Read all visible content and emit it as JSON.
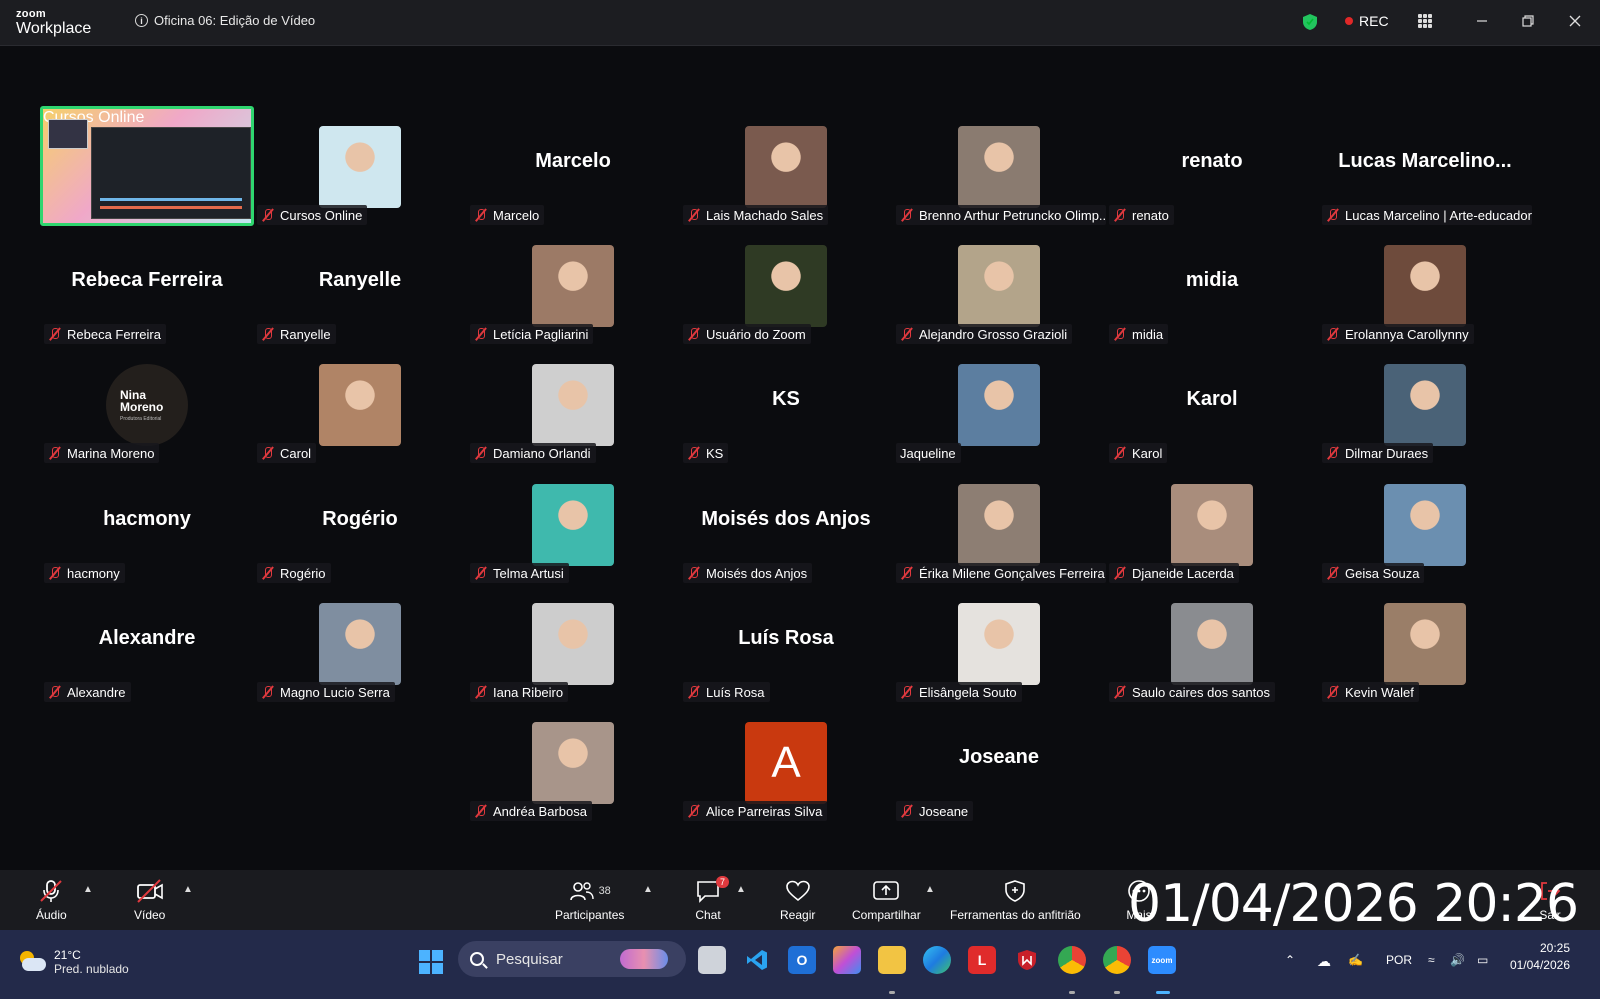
{
  "titlebar": {
    "logo_top": "zoom",
    "logo_bottom": "Workplace",
    "meeting_title": "Oficina 06: Edição de Vídeo",
    "rec_label": "REC",
    "icons": [
      "info-icon",
      "shield-icon",
      "apps-icon",
      "minimize-icon",
      "restore-icon",
      "close-icon"
    ]
  },
  "participants": [
    {
      "label": "Cursos Online",
      "big": "",
      "kind": "share"
    },
    {
      "label": "Cursos Online",
      "big": "",
      "kind": "photo",
      "color": "#cfe7ef"
    },
    {
      "label": "Marcelo",
      "big": "Marcelo",
      "kind": "name"
    },
    {
      "label": "Lais Machado Sales",
      "big": "",
      "kind": "photo",
      "color": "#7a5a4e"
    },
    {
      "label": "Brenno Arthur Petruncko Olimp...",
      "big": "",
      "kind": "photo",
      "color": "#8a7b70"
    },
    {
      "label": "renato",
      "big": "renato",
      "kind": "name"
    },
    {
      "label": "Lucas Marcelino | Arte-educador",
      "big": "Lucas  Marcelino...",
      "kind": "name"
    },
    {
      "label": "Rebeca Ferreira",
      "big": "Rebeca Ferreira",
      "kind": "name"
    },
    {
      "label": "Ranyelle",
      "big": "Ranyelle",
      "kind": "name"
    },
    {
      "label": "Letícia Pagliarini",
      "big": "",
      "kind": "photo",
      "color": "#9c7a66"
    },
    {
      "label": "Usuário do Zoom",
      "big": "",
      "kind": "photo",
      "color": "#2f3a24"
    },
    {
      "label": "Alejandro Grosso Grazioli",
      "big": "",
      "kind": "photo",
      "color": "#b3a48a"
    },
    {
      "label": "midia",
      "big": "midia",
      "kind": "name"
    },
    {
      "label": "Erolannya Carollynny",
      "big": "",
      "kind": "photo",
      "color": "#6e4b3c"
    },
    {
      "label": "Marina Moreno",
      "big": "",
      "kind": "logo",
      "logo_title": "Nina Moreno",
      "logo_sub": "Produtora Editorial"
    },
    {
      "label": "Carol",
      "big": "",
      "kind": "photo",
      "color": "#b08466"
    },
    {
      "label": "Damiano Orlandi",
      "big": "",
      "kind": "photo",
      "color": "#cfcfcf"
    },
    {
      "label": "KS",
      "big": "KS",
      "kind": "name"
    },
    {
      "label": "Jaqueline",
      "big": "",
      "kind": "photo",
      "color": "#5c7ea0",
      "muted": false
    },
    {
      "label": "Karol",
      "big": "Karol",
      "kind": "name"
    },
    {
      "label": "Dilmar Duraes",
      "big": "",
      "kind": "photo",
      "color": "#4a6277"
    },
    {
      "label": "hacmony",
      "big": "hacmony",
      "kind": "name"
    },
    {
      "label": "Rogério",
      "big": "Rogério",
      "kind": "name"
    },
    {
      "label": "Telma Artusi",
      "big": "",
      "kind": "photo",
      "color": "#3fb9ad"
    },
    {
      "label": "Moisés dos Anjos",
      "big": "Moisés dos Anjos",
      "kind": "name"
    },
    {
      "label": "Érika Milene Gonçalves Ferreira",
      "big": "",
      "kind": "photo",
      "color": "#8d7e73"
    },
    {
      "label": "Djaneide Lacerda",
      "big": "",
      "kind": "photo",
      "color": "#a98d7c"
    },
    {
      "label": "Geisa Souza",
      "big": "",
      "kind": "photo",
      "color": "#6b8fb0"
    },
    {
      "label": "Alexandre",
      "big": "Alexandre",
      "kind": "name"
    },
    {
      "label": "Magno Lucio Serra",
      "big": "",
      "kind": "photo",
      "color": "#7f8ea0"
    },
    {
      "label": "Iana Ribeiro",
      "big": "",
      "kind": "photo",
      "color": "#cdcdcd"
    },
    {
      "label": "Luís Rosa",
      "big": "Luís Rosa",
      "kind": "name"
    },
    {
      "label": "Elisângela Souto",
      "big": "",
      "kind": "photo",
      "color": "#e5e2de"
    },
    {
      "label": "Saulo caires dos santos",
      "big": "",
      "kind": "photo",
      "color": "#8a8c90"
    },
    {
      "label": "Kevin Walef",
      "big": "",
      "kind": "photo",
      "color": "#9a7e68"
    },
    {
      "label": "Andréa Barbosa",
      "big": "",
      "kind": "photo",
      "color": "#a8958a"
    },
    {
      "label": "Alice Parreiras Silva",
      "big": "",
      "kind": "letter",
      "letter": "A",
      "color": "#c9390f"
    },
    {
      "label": "Joseane",
      "big": "Joseane",
      "kind": "name"
    }
  ],
  "toolbar": {
    "audio_label": "Áudio",
    "video_label": "Vídeo",
    "participants_label": "Participantes",
    "participants_count": "38",
    "chat_label": "Chat",
    "chat_badge": "7",
    "react_label": "Reagir",
    "share_label": "Compartilhar",
    "host_tools_label": "Ferramentas do anfitrião",
    "more_label": "Mais",
    "leave_label": "Sair",
    "overlay_timestamp": "01/04/2026 20:26"
  },
  "taskbar": {
    "weather_temp": "21°C",
    "weather_desc": "Pred. nublado",
    "search_placeholder": "Pesquisar",
    "language": "POR",
    "time": "20:25",
    "date": "01/04/2026"
  }
}
